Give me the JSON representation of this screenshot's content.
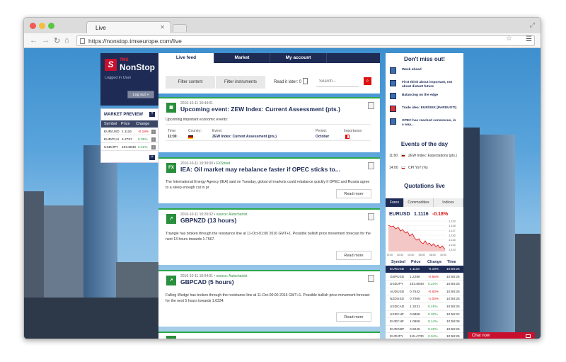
{
  "browser": {
    "tab_title": "Live",
    "url": "https://nonstop.tmseurope.com/live"
  },
  "brand": {
    "logo_letter": "S",
    "tms": "TMS",
    "name": "NonStop",
    "logged_in": "Logged in User",
    "logout": "Log out »"
  },
  "market_preview": {
    "title": "MARKET PREVIEW",
    "help": "?",
    "headers": {
      "symbol": "Symbol",
      "price": "Price",
      "change": "Change"
    },
    "rows": [
      {
        "symbol": "EUR/USD",
        "price": "1.1116",
        "change": "-0.18%",
        "dir": "dn"
      },
      {
        "symbol": "EUR/PLN",
        "price": "4.2757",
        "change": "0.05%",
        "dir": "up"
      },
      {
        "symbol": "USD/JPY",
        "price": "103.8840",
        "change": "0.22%",
        "dir": "up"
      }
    ]
  },
  "tabs": {
    "live_feed": "Live feed",
    "market": "Market",
    "my_account": "My account"
  },
  "filters": {
    "filter_content": "Filter content",
    "filter_instruments": "Filter instruments",
    "read_later": "Read it later: 0",
    "search_placeholder": "Search..."
  },
  "feed": [
    {
      "icon": "▦",
      "timestamp": "2016-10-11 10:44:01",
      "source": "",
      "title": "Upcoming event: ZEW Index: Current Assessment (pts.)",
      "body": "Upcoming important economic events:",
      "event": {
        "time_label": "Time:",
        "time": "11:00",
        "country_label": "Country:",
        "event_label": "Event:",
        "event": "ZEW Index: Current Assessment (pts.)",
        "period_label": "Period:",
        "period": "October",
        "importance_label": "Importance:"
      }
    },
    {
      "icon": "FX",
      "timestamp": "2016-10-11 10:30:00",
      "source": "FXStreet",
      "title": "IEA: Oil market may rebalance faster if OPEC sticks to...",
      "body": "The International Energy Agency (IEA) said on Tuesday, global oil markets could rebalance quickly if OPEC and Russia agree to a steep enough cut in pr",
      "read_more": "Read more"
    },
    {
      "icon": "↗",
      "timestamp": "2016-10-11 10:20:02",
      "source": "source: Autochartist",
      "title": "GBPNZD (13 hours)",
      "body": "Triangle has broken through the resistance line at 11-Oct-01:00 2016 GMT+1. Possible bullish price movement forecast for the next 13 hours towards 1.7567.",
      "read_more": "Read more"
    },
    {
      "icon": "↗",
      "timestamp": "2016-10-11 10:04:01",
      "source": "source: Autochartist",
      "title": "GBPCAD (5 hours)",
      "body": "Falling Wedge has broken through the resistance line at 11-Oct-00:00 2016 GMT+1. Possible bullish price movement forecast for the next 5 hours towards 1.6334.",
      "read_more": "Read more"
    }
  ],
  "dont_miss": {
    "title": "Don't miss out!",
    "items": [
      "Week ahead",
      "First think about important, not about distant future",
      "Balancing on the edge",
      "Trade idea: EUR/SEK [PARDUOTI]",
      "OPEC has reached consensus, in a way..."
    ]
  },
  "events_of_day": {
    "title": "Events of the day",
    "items": [
      {
        "time": "11:00",
        "name": "ZEW Index: Expectations (pts.)"
      },
      {
        "time": "14:00",
        "name": "CPI YoY (%)"
      }
    ]
  },
  "quotations": {
    "title": "Quotations live",
    "tabs": [
      "Forex",
      "Commodities",
      "Indices"
    ],
    "symbol": "EURUSD",
    "price": "1.1116",
    "change": "-0.18%",
    "chart_yticks": [
      "1.119",
      "1.118",
      "1.117",
      "1.116",
      "1.115",
      "1.114",
      "1.113"
    ],
    "chart_xticks": [
      "00:00",
      "02:00",
      "04:00",
      "06:00",
      "08:00",
      "10:00"
    ],
    "headers": {
      "symbol": "Symbol",
      "price": "Price",
      "change": "Change",
      "time": "Time"
    },
    "rows": [
      {
        "symbol": "EURUSD",
        "price": "1.1116",
        "change": "-0.18%",
        "time": "10:58:25",
        "dir": "dn"
      },
      {
        "symbol": "GBPUSD",
        "price": "1.2288",
        "change": "-0.56%",
        "time": "10:58:25",
        "dir": "dn"
      },
      {
        "symbol": "USDJPY",
        "price": "103.8840",
        "change": "0.22%",
        "time": "10:58:25",
        "dir": "up"
      },
      {
        "symbol": "AUDUSD",
        "price": "0.7542",
        "change": "-0.63%",
        "time": "10:58:25",
        "dir": "dn"
      },
      {
        "symbol": "NZDUSD",
        "price": "0.7065",
        "change": "-1.00%",
        "time": "10:58:25",
        "dir": "dn"
      },
      {
        "symbol": "USDCAD",
        "price": "1.3231",
        "change": "0.45%",
        "time": "10:58:25",
        "dir": "up"
      },
      {
        "symbol": "USDCHF",
        "price": "0.9858",
        "change": "0.32%",
        "time": "10:58:22",
        "dir": "up"
      },
      {
        "symbol": "EURCHF",
        "price": "1.0958",
        "change": "0.14%",
        "time": "10:58:08",
        "dir": "up"
      },
      {
        "symbol": "EURGBP",
        "price": "0.9045",
        "change": "0.40%",
        "time": "10:58:25",
        "dir": "up"
      },
      {
        "symbol": "EURJPY",
        "price": "115.4730",
        "change": "0.04%",
        "time": "10:58:25",
        "dir": "up"
      },
      {
        "symbol": "EURNOK",
        "price": "9.8466",
        "change": "0.53%",
        "time": "10:58:25",
        "dir": "up"
      }
    ]
  },
  "chat": {
    "label": "Chat now"
  },
  "colors": {
    "navy": "#1d2b55",
    "red": "#c8102e",
    "green": "#2a9a3a"
  }
}
